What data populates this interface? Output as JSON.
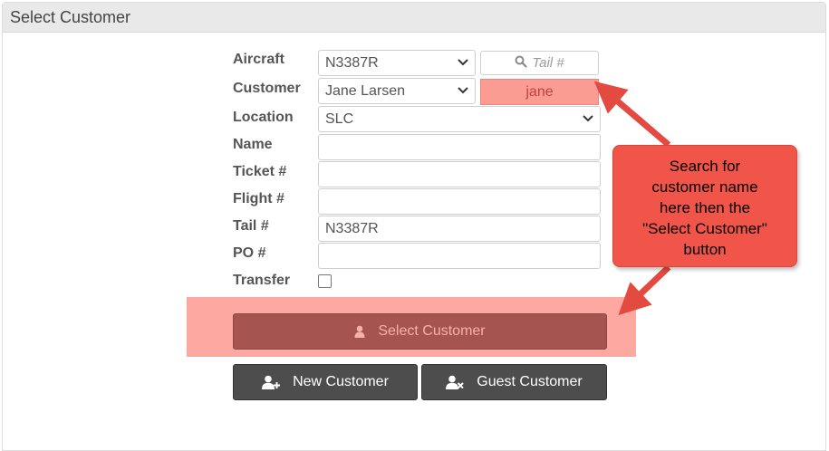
{
  "panel": {
    "title": "Select Customer"
  },
  "form": {
    "labels": {
      "aircraft": "Aircraft",
      "customer": "Customer",
      "location": "Location",
      "name": "Name",
      "ticket": "Ticket #",
      "flight": "Flight #",
      "tail": "Tail #",
      "po": "PO #",
      "transfer": "Transfer"
    },
    "values": {
      "aircraft": "N3387R",
      "customer": "Jane Larsen",
      "location": "SLC",
      "name": "",
      "ticket": "",
      "flight": "",
      "tail": "N3387R",
      "po": ""
    },
    "tail_search_placeholder": "Tail #",
    "customer_search_value": "jane",
    "transfer_checked": false
  },
  "buttons": {
    "select_customer": "Select Customer",
    "new_customer": "New Customer",
    "guest_customer": "Guest Customer"
  },
  "callout": {
    "lines": [
      "Search for",
      "customer name",
      "here then the",
      "\"Select Customer\"",
      "button"
    ]
  },
  "colors": {
    "highlight": "#fda8a1",
    "callout": "#f1554a",
    "select_button": "#a65450",
    "dark_button": "#4d4d4d"
  },
  "icons": {
    "search": "search-icon",
    "user": "user-icon",
    "user_plus": "user-plus-icon",
    "user_times": "user-times-icon",
    "chevron": "chevron-down-icon"
  }
}
